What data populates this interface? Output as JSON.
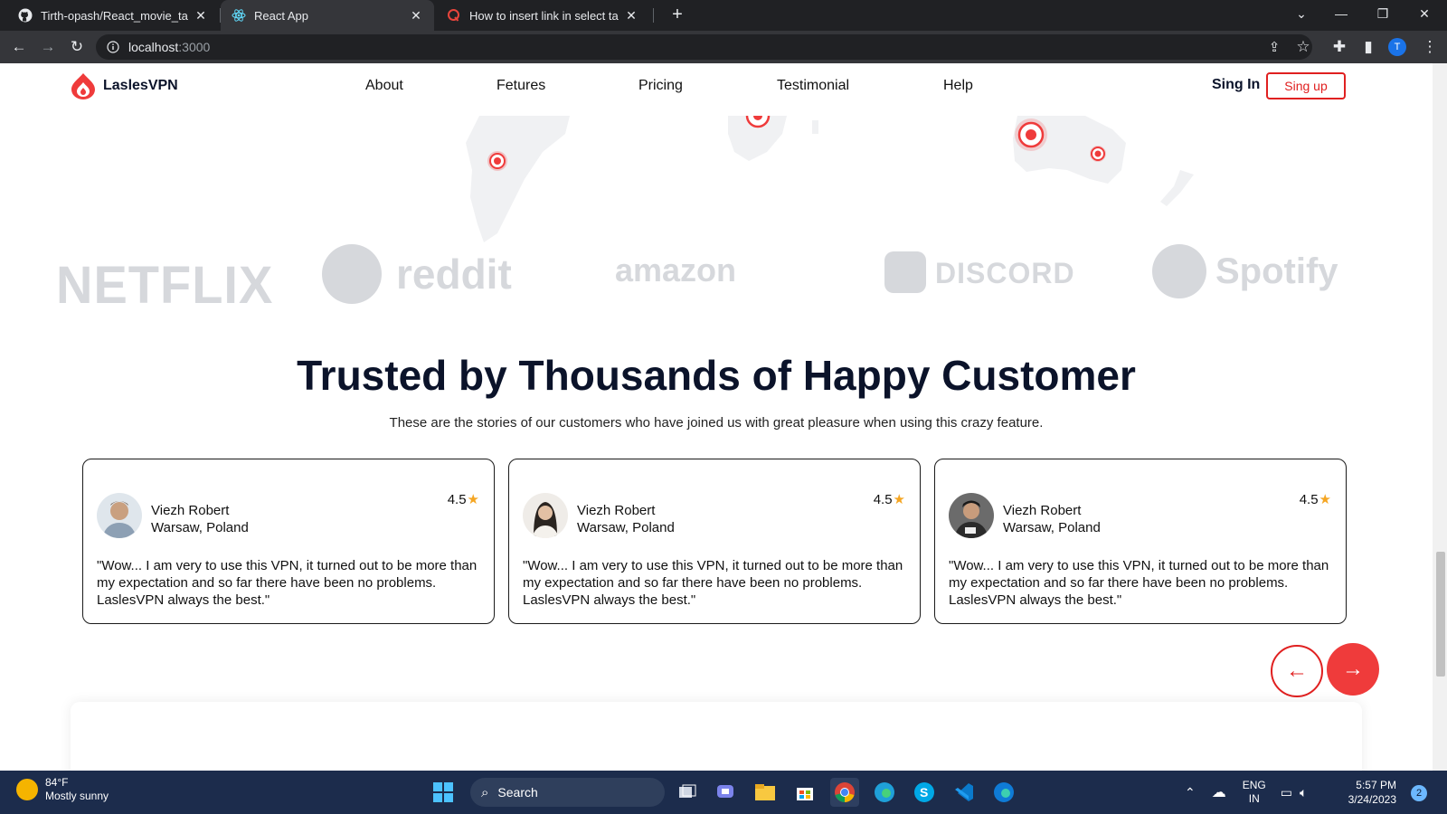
{
  "browser": {
    "tabs": [
      {
        "title": "Tirth-opash/React_movie_task",
        "icon": "github-icon"
      },
      {
        "title": "React App",
        "icon": "react-icon"
      },
      {
        "title": "How to insert link in select tag in",
        "icon": "quora-icon"
      }
    ],
    "url_host": "localhost",
    "url_port": ":3000",
    "profile_initial": "T"
  },
  "site": {
    "logo_text": "LaslesVPN",
    "nav": [
      "About",
      "Fetures",
      "Pricing",
      "Testimonial",
      "Help"
    ],
    "sign_in": "Sing In",
    "sign_up": "Sing up",
    "brand_logos": [
      "NETFLIX",
      "reddit",
      "amazon",
      "DISCORD",
      "Spotify"
    ],
    "heading": "Trusted by Thousands of Happy Customer",
    "subheading": "These are the stories of our customers who have joined us with great pleasure when using this crazy feature.",
    "testimonials": [
      {
        "name": "Viezh Robert",
        "location": "Warsaw, Poland",
        "rating": "4.5",
        "quote": "\"Wow... I am very to use this VPN, it turned out to be more than my expectation and so far there have been no problems. LaslesVPN always the best.\""
      },
      {
        "name": "Viezh Robert",
        "location": "Warsaw, Poland",
        "rating": "4.5",
        "quote": "\"Wow... I am very to use this VPN, it turned out to be more than my expectation and so far there have been no problems. LaslesVPN always the best.\""
      },
      {
        "name": "Viezh Robert",
        "location": "Warsaw, Poland",
        "rating": "4.5",
        "quote": "\"Wow... I am very to use this VPN, it turned out to be more than my expectation and so far there have been no problems. LaslesVPN always the best.\""
      }
    ],
    "accent_color": "#ef3b3b"
  },
  "taskbar": {
    "temperature": "84°F",
    "weather": "Mostly sunny",
    "search_label": "Search",
    "lang": "ENG",
    "region": "IN",
    "time": "5:57 PM",
    "date": "3/24/2023",
    "notifications": "2"
  }
}
